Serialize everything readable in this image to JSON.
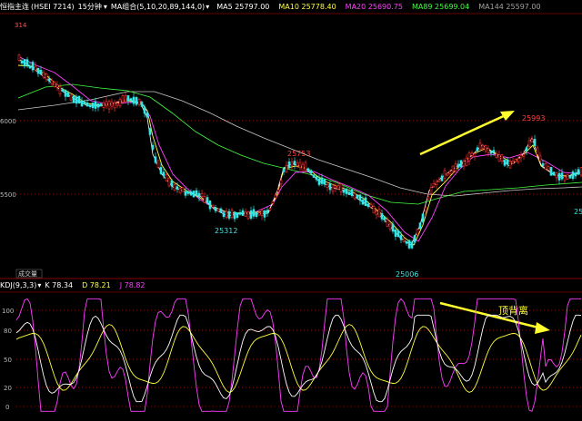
{
  "header": {
    "title": "恒指主连",
    "code": "(HSEI 7214)",
    "period": "15分钟",
    "period_arrow": "▾",
    "ma_group": "MA组合(5,10,20,89,144,0)",
    "ma_group_arrow": "▾",
    "ma5": "MA5 25797.00",
    "ma10": "MA10 25778.40",
    "ma20": "MA20 25690.75",
    "ma89": "MA89 25699.04",
    "ma144": "MA144 25597.00"
  },
  "kdj_header": {
    "name": "KDJ(9,3,3)",
    "arrow": "▾",
    "k": "K 78.34",
    "d": "D 78.21",
    "j": "J 78.82"
  },
  "price_axis": [
    "314",
    "6000",
    "5500"
  ],
  "price_labels": [
    "25993",
    "25753",
    "25312",
    "25006"
  ],
  "partial_right_label": "25",
  "volume_tab": "成交量",
  "annotation": "顶背离",
  "kdj_axis": [
    "100",
    "80",
    "50",
    "20",
    "0"
  ],
  "colors": {
    "up": "#ff3030",
    "down": "#30e8e8",
    "ma5": "#ffffff",
    "ma10": "#ffff40",
    "ma20": "#ff40ff",
    "ma89": "#40ff40",
    "ma144": "#c0c0c0",
    "arrow": "#ffff30",
    "gridline": "#801010"
  }
}
